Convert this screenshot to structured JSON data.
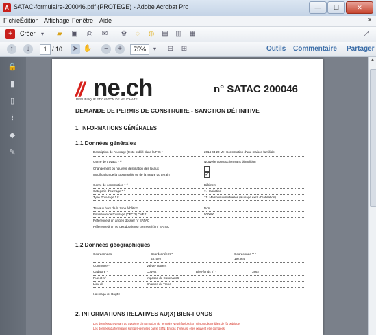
{
  "window": {
    "title": "SATAC-formulaire-200046.pdf (PROTEGE) - Adobe Acrobat Pro",
    "app_icon": "acrobat-icon",
    "controls": [
      "minimize",
      "maximize",
      "close"
    ]
  },
  "menu": {
    "items": [
      "Fichier",
      "Édition",
      "Affichage",
      "Fenêtre",
      "Aide"
    ],
    "close_symbol": "×"
  },
  "toolbar": {
    "create_label": "Créer",
    "icons": [
      "create-icon",
      "folder-icon",
      "save-icon",
      "print-icon",
      "mail-icon",
      "settings-icon",
      "comment-icon",
      "comments-icon",
      "document-icon",
      "share-icon",
      "export-icon",
      "expand-icon"
    ]
  },
  "nav": {
    "current_page": "1",
    "total_pages": "/ 10",
    "zoom": "75%",
    "tabs": [
      "Outils",
      "Commentaire",
      "Partager"
    ]
  },
  "sidebar": {
    "icons": [
      "lock-icon",
      "pages-icon",
      "bookmark-icon",
      "attachment-icon",
      "layers-icon",
      "signature-icon"
    ]
  },
  "document": {
    "logo_text": "ne.ch",
    "logo_sub": "RÉPUBLIQUE ET CANTON DE NEUCHÂTEL",
    "satac_number": "n° SATAC 200046",
    "heading": "DEMANDE DE PERMIS DE CONSTRUIRE - SANCTION DÉFINITIVE",
    "section1": "1. INFORMATIONS GÉNÉRALES",
    "sub1": "1.1 Données générales",
    "rows_general": [
      {
        "label": "Description de l'ouvrage (texte publié dans la FO) *",
        "value": "2014 04 20 MH Construction d'une maison familiale"
      },
      {
        "label": "Genre de travaux * ¹⁾",
        "value": "Nouvelle construction sans démolition"
      },
      {
        "label": "Changement ou nouvelle destination des locaux",
        "value": ""
      },
      {
        "label": "Modification de la topographie ou de la nature du terrain",
        "value": "✓"
      },
      {
        "label": "Genre de construction * ¹⁾",
        "value": "Bâtiment"
      },
      {
        "label": "Catégorie d'ouvrage * ¹⁾",
        "value": "7. Habitation"
      },
      {
        "label": "Type d'ouvrage * ¹⁾",
        "value": "71. Maisons individuelles (à usage excl. d'habitation)"
      },
      {
        "label": "Travaux hors de la zone à bâtir *",
        "value": "Non"
      },
      {
        "label": "Estimation de l'ouvrage (CFC 2) CHF *",
        "value": "500000"
      },
      {
        "label": "Référence à un ancien dossier n° SATAC",
        "value": ""
      },
      {
        "label": "Référence à un ou des dossier(s) connexe(s) n° SATAC",
        "value": ""
      }
    ],
    "sub2": "1.2 Données géographiques",
    "geo": {
      "coord_label": "Coordonnées",
      "coord_x_label": "Coordonnée X *",
      "coord_x_value": "537570",
      "coord_y_label": "Coordonnée Y *",
      "coord_y_value": "197364",
      "rows": [
        {
          "label": "Commune *",
          "value": "Val-de-Travers"
        },
        {
          "label": "Cadastre *",
          "value": "Couvet"
        },
        {
          "label": "Rue et n°",
          "value": "Impasse du Couchant 5"
        },
        {
          "label": "Lieu-dit",
          "value": "Champs du Tronc"
        }
      ],
      "bienfonds_label": "Bien-fonds n° *",
      "bienfonds_value": "3862"
    },
    "footnote": "¹ A usage du RegBL",
    "section2": "2. INFORMATIONS RELATIVES AU(X) BIEN-FONDS",
    "red_note_1": "Les données provenant du Système d'information du Territoire Neuchâtelois (SITN) sont disponibles de fût publique.",
    "red_note_2": "Les données du formulaire sont pré-remplies par le SITN. En cas d'erreurs, elles peuvent être corrigées."
  }
}
